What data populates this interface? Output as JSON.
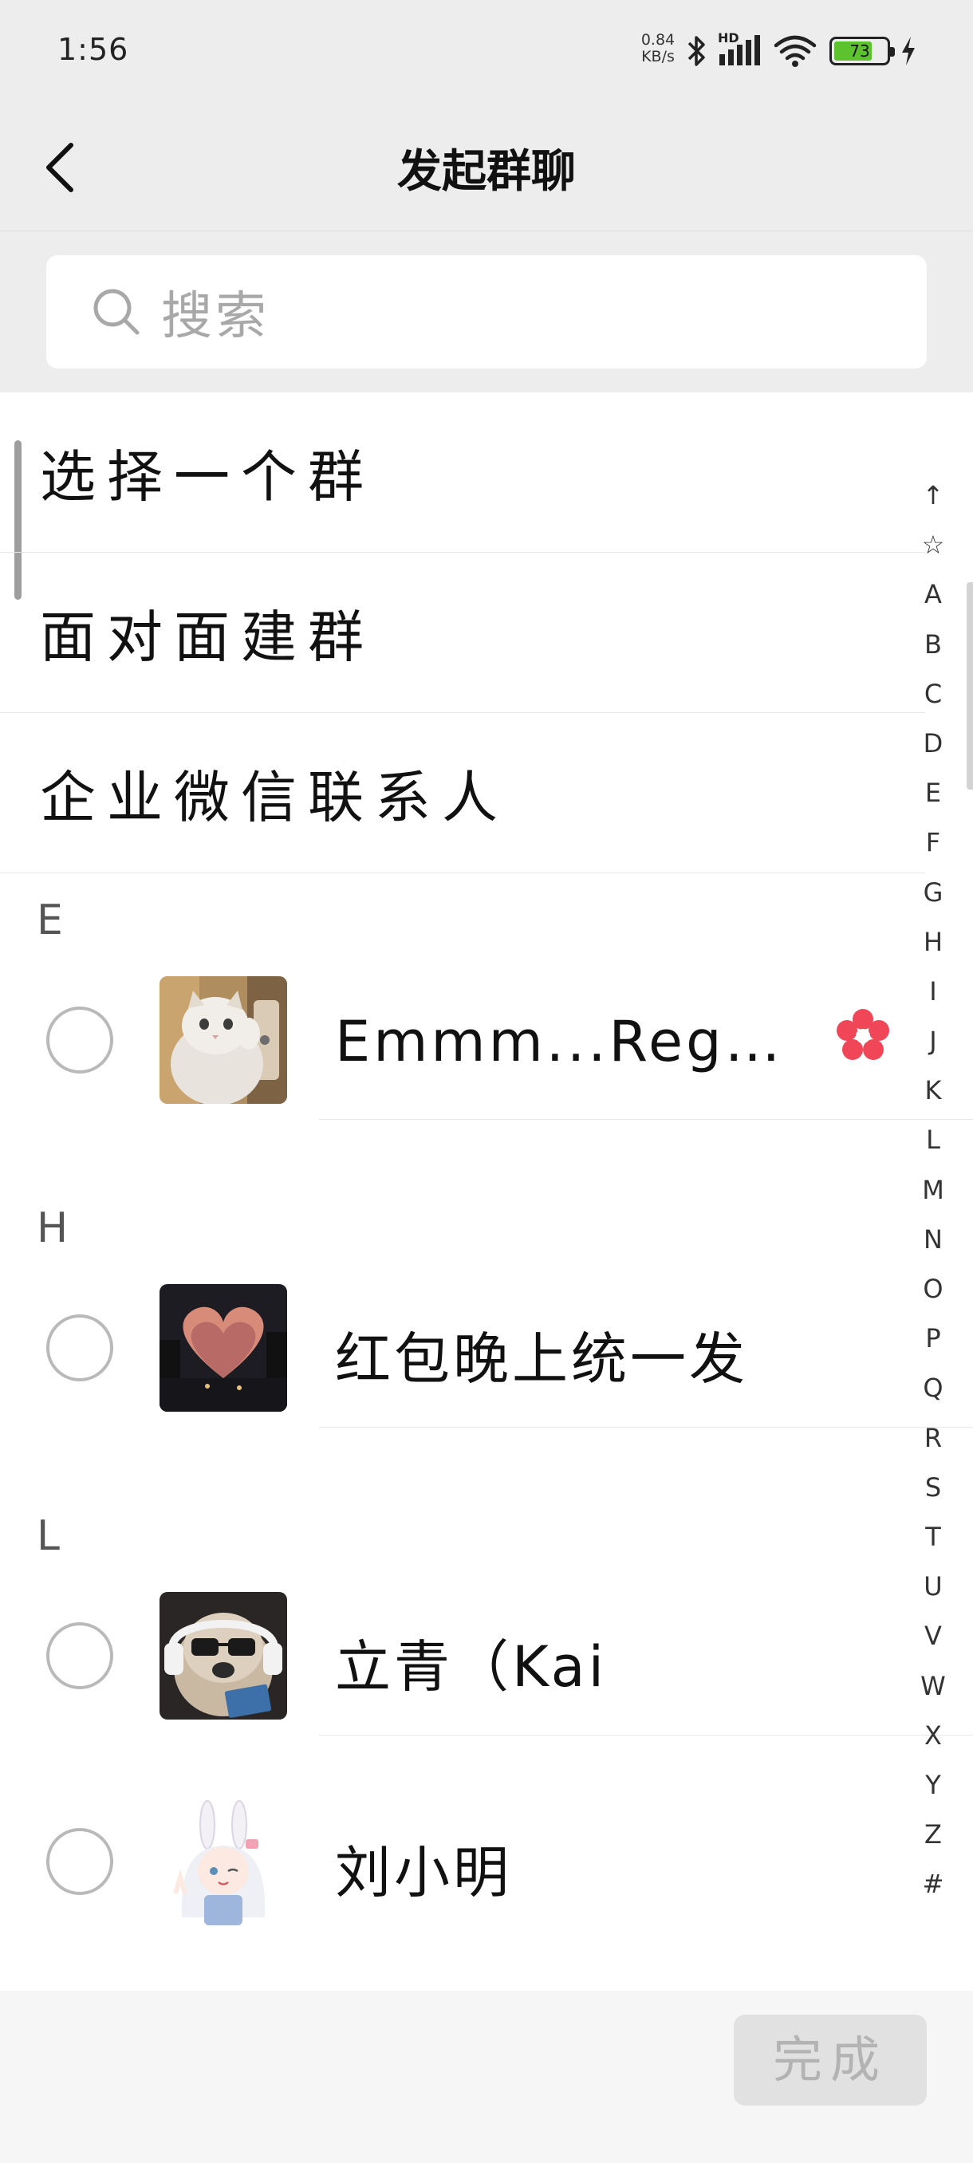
{
  "status_bar": {
    "time": "1:56",
    "net_speed_value": "0.84",
    "net_speed_unit": "KB/s",
    "signal_label": "HD",
    "battery_level": "73",
    "battery_color": "#5cc22d"
  },
  "nav": {
    "title": "发起群聊"
  },
  "search": {
    "placeholder": "搜索"
  },
  "options": [
    {
      "label": "选择一个群"
    },
    {
      "label": "面对面建群"
    },
    {
      "label": "企业微信联系人"
    }
  ],
  "sections": [
    {
      "letter": "E",
      "contacts": [
        {
          "name": "Emmm...Reg…",
          "avatar": "cat-photo",
          "checked": false,
          "badge": "flower-icon"
        }
      ]
    },
    {
      "letter": "H",
      "contacts": [
        {
          "name": "红包晚上统一发",
          "avatar": "sunset-street-photo",
          "checked": false
        }
      ]
    },
    {
      "letter": "L",
      "contacts": [
        {
          "name": "立青（Kai",
          "avatar": "sunglasses-dog-photo",
          "checked": false
        },
        {
          "name": "刘小明",
          "avatar": "anime-bunny-girl",
          "checked": false
        }
      ]
    }
  ],
  "alphabet_index": [
    "↑",
    "☆",
    "A",
    "B",
    "C",
    "D",
    "E",
    "F",
    "G",
    "H",
    "I",
    "J",
    "K",
    "L",
    "M",
    "N",
    "O",
    "P",
    "Q",
    "R",
    "S",
    "T",
    "U",
    "V",
    "W",
    "X",
    "Y",
    "Z",
    "#"
  ],
  "bottom": {
    "done_label": "完成",
    "done_enabled": false
  },
  "colors": {
    "background": "#ededed",
    "accent_flower": "#f04657",
    "battery_green": "#5cc22d"
  }
}
